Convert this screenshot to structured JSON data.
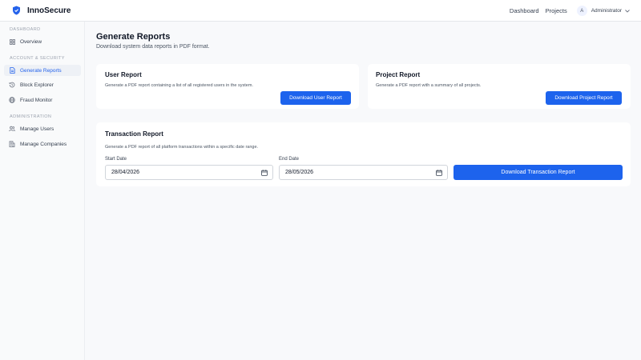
{
  "header": {
    "brand": "InnoSecure",
    "nav": [
      "Dashboard",
      "Projects"
    ],
    "user": {
      "avatar_initial": "A",
      "name": "Administrator"
    }
  },
  "sidebar": {
    "sections": [
      {
        "label": "DASHBOARD",
        "items": [
          {
            "label": "Overview",
            "icon": "grid-icon"
          }
        ]
      },
      {
        "label": "ACCOUNT & SECURITY",
        "items": [
          {
            "label": "Generate Reports",
            "icon": "document-icon",
            "active": true
          },
          {
            "label": "Block Explorer",
            "icon": "history-icon"
          },
          {
            "label": "Fraud Monitor",
            "icon": "globe-icon"
          }
        ]
      },
      {
        "label": "ADMINISTRATION",
        "items": [
          {
            "label": "Manage Users",
            "icon": "users-icon"
          },
          {
            "label": "Manage Companies",
            "icon": "building-icon"
          }
        ]
      }
    ]
  },
  "main": {
    "title": "Generate Reports",
    "subtitle": "Download system data reports in PDF format.",
    "user_report": {
      "title": "User Report",
      "description": "Generate a PDF report containing a list of all registered users in the system.",
      "button": "Download User Report"
    },
    "project_report": {
      "title": "Project Report",
      "description": "Generate a PDF report with a summary of all projects.",
      "button": "Download Project Report"
    },
    "transaction_report": {
      "title": "Transaction Report",
      "description": "Generate a PDF report of all platform transactions within a specific date range.",
      "start_label": "Start Date",
      "start_value": "28/04/2026",
      "end_label": "End Date",
      "end_value": "28/05/2026",
      "button": "Download Transaction Report"
    }
  },
  "colors": {
    "accent": "#1d63ed",
    "active_text": "#2563eb",
    "background": "#f8f9fb"
  }
}
